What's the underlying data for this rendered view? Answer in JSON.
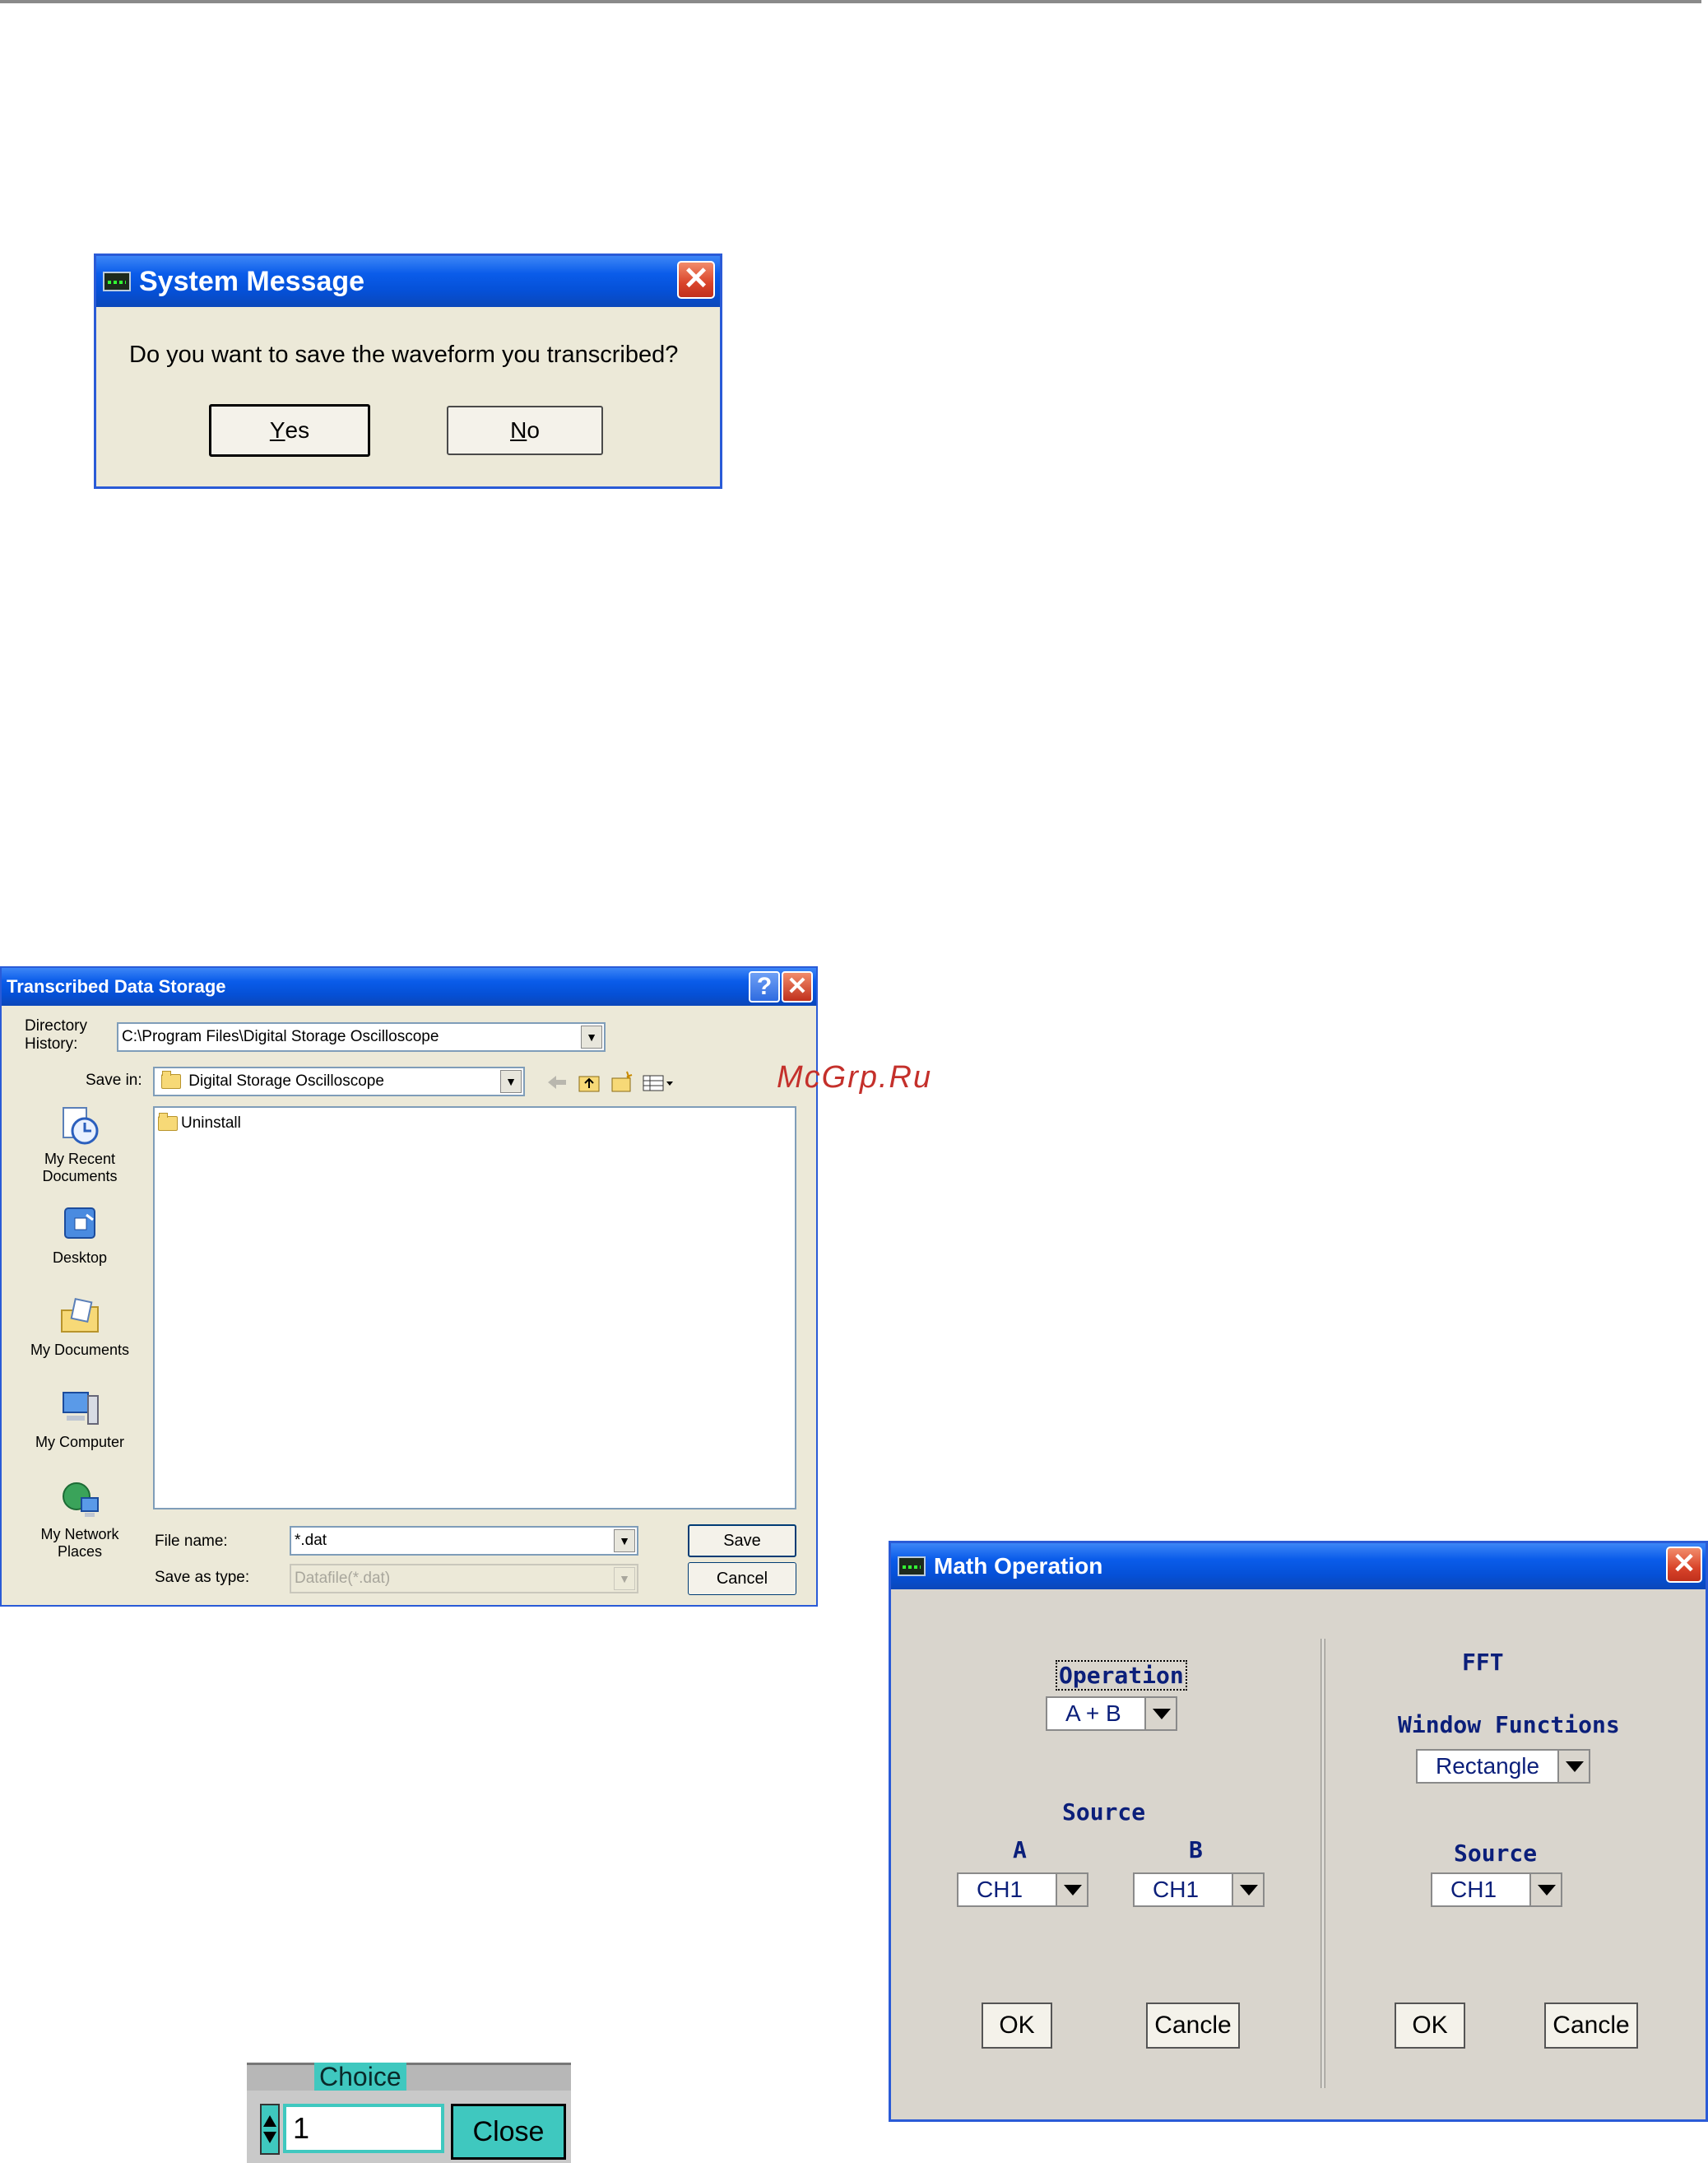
{
  "watermark": "McGrp.Ru",
  "system_message": {
    "title": "System Message",
    "text": "Do you want to save the waveform you transcribed?",
    "yes_mnemonic": "Y",
    "yes_rest": "es",
    "no_mnemonic": "N",
    "no_rest": "o",
    "close_glyph": "✕"
  },
  "file_dialog": {
    "title": "Transcribed Data Storage",
    "help_glyph": "?",
    "close_glyph": "✕",
    "directory_history_label_1": "Directory",
    "directory_history_label_2": "History:",
    "directory_history_value": "C:\\Program Files\\Digital Storage Oscilloscope",
    "save_in_label": "Save in:",
    "save_in_value": "Digital Storage Oscilloscope",
    "places": [
      {
        "line1": "My Recent",
        "line2": "Documents"
      },
      {
        "line1": "Desktop",
        "line2": ""
      },
      {
        "line1": "My Documents",
        "line2": ""
      },
      {
        "line1": "My Computer",
        "line2": ""
      },
      {
        "line1": "My Network",
        "line2": "Places"
      }
    ],
    "files": [
      "Uninstall"
    ],
    "file_name_label": "File name:",
    "file_name_value": "*.dat",
    "save_type_label": "Save as type:",
    "save_type_value": "Datafile(*.dat)",
    "save_button": "Save",
    "cancel_button": "Cancel"
  },
  "math_operation": {
    "title": "Math Operation",
    "close_glyph": "✕",
    "operation_label": "Operation",
    "operation_value": "A + B",
    "source_label": "Source",
    "a_label": "A",
    "b_label": "B",
    "a_value": "CH1",
    "b_value": "CH1",
    "ok_left": "OK",
    "cancel_left": "Cancle",
    "fft_label": "FFT",
    "window_functions_label": "Window Functions",
    "window_value": "Rectangle",
    "fft_source_label": "Source",
    "fft_source_value": "CH1",
    "ok_right": "OK",
    "cancel_right": "Cancle"
  },
  "choice": {
    "label": "Choice",
    "value": "1",
    "close_button": "Close"
  },
  "colors": {
    "xp_title": "#0550d6",
    "dialog_face": "#ece9d8",
    "math_label": "#0b1f7a",
    "choice_teal": "#3fc8bf",
    "watermark": "#c4302b"
  }
}
